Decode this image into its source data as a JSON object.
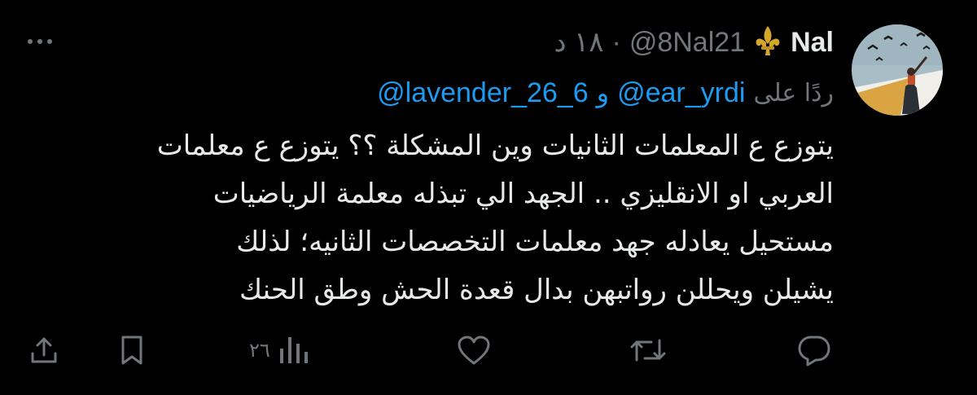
{
  "tweet": {
    "author_name": "Nal",
    "author_emoji": "⚜️",
    "handle": "@8Nal21",
    "separator": "·",
    "time": "١٨ د",
    "reply_prefix": "ردًا على",
    "reply_mentions": [
      "@ear_yrdi",
      "@lavender_26_6"
    ],
    "reply_and": "و",
    "body_lines": [
      "يتوزع ع المعلمات الثانيات وين المشكلة ؟؟ يتوزع ع معلمات",
      "العربي او الانقليزي .. الجهد الي تبذله معلمة الرياضيات",
      "مستحيل يعادله جهد معلمات التخصصات الثانيه؛ لذلك",
      "يشيلن ويحللن رواتبهن بدال قعدة الحش وطق الحنك"
    ]
  },
  "actions": {
    "reply_icon": "reply-bubble-icon",
    "retweet_icon": "retweet-icon",
    "like_icon": "heart-icon",
    "views_icon": "bar-chart-icon",
    "views_count": "٢٦",
    "bookmark_icon": "bookmark-icon",
    "share_icon": "share-upload-icon"
  },
  "colors": {
    "background": "#000000",
    "text": "#e7e9ea",
    "muted": "#71767b",
    "link": "#1d9bf0",
    "fleur": "#d4a62a"
  }
}
